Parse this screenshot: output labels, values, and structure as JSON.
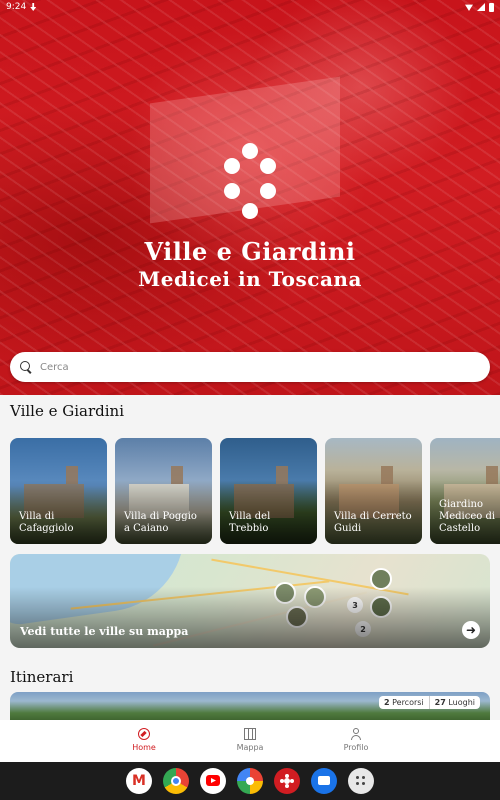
{
  "status_bar": {
    "time": "9:24"
  },
  "hero": {
    "title_line1": "Ville e Giardini",
    "title_line2": "Medicei in Toscana",
    "logo_icon": "medici-balls-icon"
  },
  "search": {
    "placeholder": "Cerca",
    "value": ""
  },
  "villas_section": {
    "title": "Ville e Giardini",
    "items": [
      {
        "name": "Villa di Cafaggiolo",
        "color": "#3a6ea5"
      },
      {
        "name": "Villa di Poggio a Caiano",
        "color": "#5c7fa8"
      },
      {
        "name": "Villa del Trebbio",
        "color": "#2f5e8c"
      },
      {
        "name": "Villa di Cerreto Guidi",
        "color": "#7f8f6a"
      },
      {
        "name": "Giardino Mediceo di Castello",
        "color": "#6d7a5c"
      }
    ]
  },
  "map_card": {
    "label": "Vedi tutte le ville su mappa",
    "cluster_counts": [
      "3",
      "2"
    ],
    "arrow_icon": "arrow-right-icon"
  },
  "itinerari_section": {
    "title": "Itinerari",
    "badge_percorsi_count": "2",
    "badge_percorsi_label": "Percorsi",
    "badge_luoghi_count": "27",
    "badge_luoghi_label": "Luoghi"
  },
  "bottom_nav": {
    "items": [
      {
        "label": "Home",
        "icon": "compass-icon",
        "active": true
      },
      {
        "label": "Mappa",
        "icon": "map-icon",
        "active": false
      },
      {
        "label": "Profilo",
        "icon": "user-icon",
        "active": false
      }
    ]
  },
  "dock": {
    "apps": [
      "gmail-icon",
      "chrome-icon",
      "youtube-icon",
      "photos-icon",
      "villas-app-icon",
      "messages-icon",
      "apps-icon"
    ]
  },
  "colors": {
    "brand_red": "#d11d22",
    "background": "#f4f4f4"
  }
}
